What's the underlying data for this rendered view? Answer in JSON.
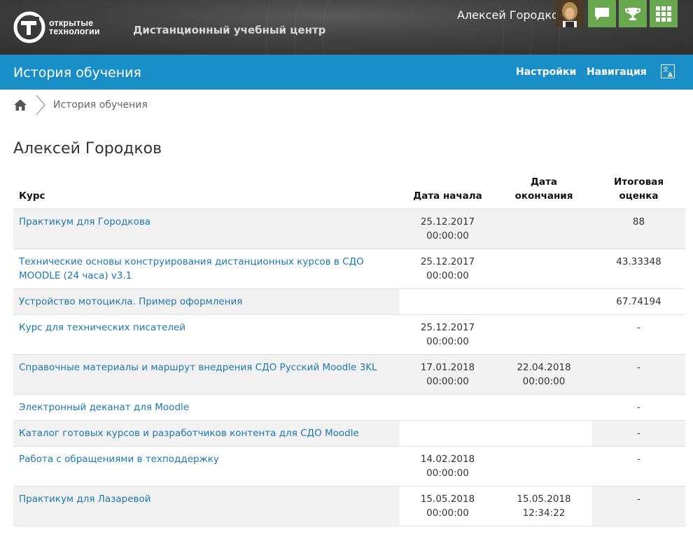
{
  "header": {
    "logo_line1": "открытые",
    "logo_line2": "технологии",
    "site_name": "Дистанционный учебный центр",
    "user_name": "Алексей Городков",
    "tiles": [
      {
        "icon": "message-icon"
      },
      {
        "icon": "trophy-icon"
      },
      {
        "icon": "grid-icon"
      }
    ],
    "tile_color": "#6aa84f"
  },
  "bluebar": {
    "title": "История обучения",
    "settings": "Настройки",
    "navigation": "Навигация",
    "lang_icon": "translate-icon",
    "color": "#1a8fc7"
  },
  "breadcrumb": {
    "home_icon": "home-icon",
    "current": "История обучения"
  },
  "person_name": "Алексей Городков",
  "table": {
    "headers": {
      "course": "Курс",
      "start": "Дата начала",
      "end": "Дата окончания",
      "grade_line1": "Итоговая",
      "grade_line2": "оценка"
    },
    "rows": [
      {
        "course": "Практикум для Городкова",
        "start_date": "25.12.2017",
        "start_time": "00:00:00",
        "end_date": "",
        "end_time": "",
        "grade": "88"
      },
      {
        "course": "Технические основы конструирования дистанционных курсов в СДО MOODLE (24 часа) v3.1",
        "start_date": "25.12.2017",
        "start_time": "00:00:00",
        "end_date": "",
        "end_time": "",
        "grade": "43.33348"
      },
      {
        "course": "Устройство мотоцикла. Пример оформления",
        "start_date": "",
        "start_time": "",
        "end_date": "",
        "end_time": "",
        "grade": "67.74194"
      },
      {
        "course": "Курс для технических писателей",
        "start_date": "25.12.2017",
        "start_time": "00:00:00",
        "end_date": "",
        "end_time": "",
        "grade": "-"
      },
      {
        "course": "Справочные материалы и маршрут внедрения СДО Русский Moodle 3KL",
        "start_date": "17.01.2018",
        "start_time": "00:00:00",
        "end_date": "22.04.2018",
        "end_time": "00:00:00",
        "grade": "-"
      },
      {
        "course": "Электронный деканат для Moodle",
        "start_date": "",
        "start_time": "",
        "end_date": "",
        "end_time": "",
        "grade": "-"
      },
      {
        "course": "Каталог готовых курсов и разработчиков контента для СДО Moodle",
        "start_date": "",
        "start_time": "",
        "end_date": "",
        "end_time": "",
        "grade": "-"
      },
      {
        "course": "Работа с обращениями в техподдержку",
        "start_date": "14.02.2018",
        "start_time": "00:00:00",
        "end_date": "",
        "end_time": "",
        "grade": "-"
      },
      {
        "course": "Практикум для Лазаревой",
        "start_date": "15.05.2018",
        "start_time": "00:00:00",
        "end_date": "15.05.2018",
        "end_time": "12:34:22",
        "grade": "-"
      }
    ]
  }
}
